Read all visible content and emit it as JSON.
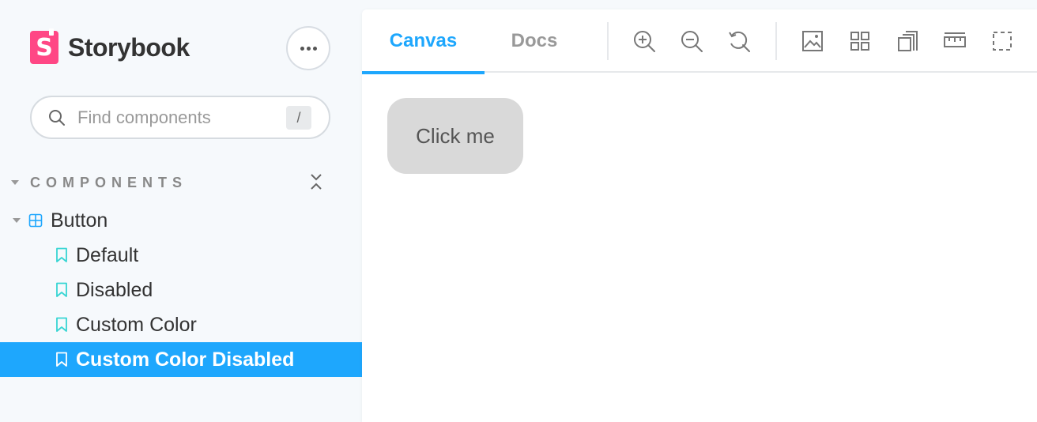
{
  "app": {
    "name": "Storybook",
    "logo_letter": "S",
    "accent_color": "#1ea7fd",
    "brand_color": "#ff4785"
  },
  "sidebar": {
    "search": {
      "placeholder": "Find components",
      "shortcut": "/"
    },
    "section_title": "COMPONENTS",
    "group": {
      "label": "Button",
      "icon": "component-icon"
    },
    "stories": [
      {
        "label": "Default",
        "icon": "bookmark-icon",
        "active": false
      },
      {
        "label": "Disabled",
        "icon": "bookmark-icon",
        "active": false
      },
      {
        "label": "Custom Color",
        "icon": "bookmark-icon",
        "active": false
      },
      {
        "label": "Custom Color Disabled",
        "icon": "bookmark-icon",
        "active": true
      }
    ]
  },
  "toolbar": {
    "tabs": [
      {
        "label": "Canvas",
        "active": true
      },
      {
        "label": "Docs",
        "active": false
      }
    ],
    "tools": [
      "zoom-in-icon",
      "zoom-out-icon",
      "zoom-reset-icon",
      "background-icon",
      "grid-icon",
      "viewport-icon",
      "measure-icon",
      "outline-icon"
    ]
  },
  "canvas": {
    "button_label": "Click me"
  }
}
